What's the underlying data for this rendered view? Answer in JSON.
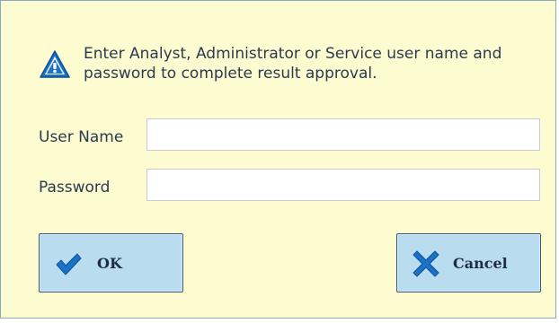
{
  "dialog": {
    "message": "Enter Analyst, Administrator or Service user name and password to complete result approval.",
    "icon": "warning-icon"
  },
  "form": {
    "username_label": "User Name",
    "username_value": "",
    "password_label": "Password",
    "password_value": ""
  },
  "buttons": {
    "ok_label": "OK",
    "ok_icon": "checkmark-icon",
    "cancel_label": "Cancel",
    "cancel_icon": "close-icon"
  },
  "colors": {
    "background": "#fdfbd0",
    "button_fill": "#b9dcef",
    "icon_blue": "#1a73c9",
    "text": "#2b3a4f"
  }
}
